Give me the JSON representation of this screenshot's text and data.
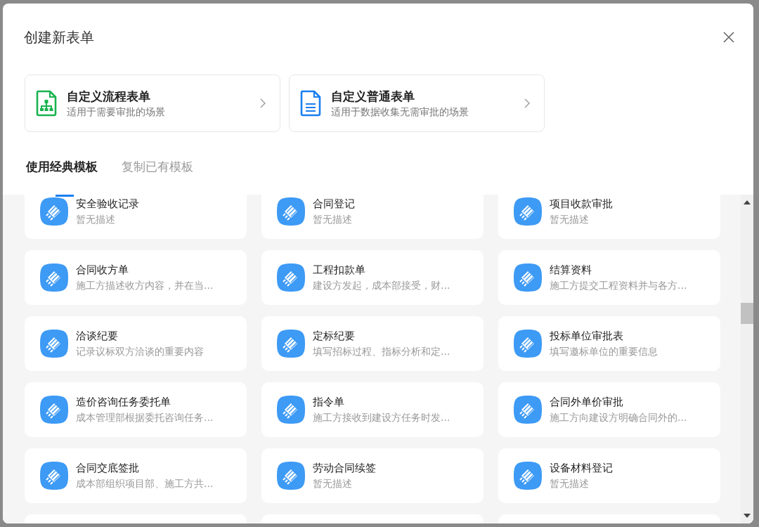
{
  "dialog": {
    "title": "创建新表单"
  },
  "create_options": [
    {
      "kind": "flow",
      "title": "自定义流程表单",
      "description": "适用于需要审批的场景"
    },
    {
      "kind": "normal",
      "title": "自定义普通表单",
      "description": "适用于数据收集无需审批的场景"
    }
  ],
  "tabs": [
    {
      "label": "使用经典模板",
      "selected": true
    },
    {
      "label": "复制已有模板",
      "selected": false
    }
  ],
  "templates": [
    {
      "name": "安全验收记录",
      "description": "暂无描述"
    },
    {
      "name": "合同登记",
      "description": "暂无描述"
    },
    {
      "name": "项目收款审批",
      "description": "暂无描述"
    },
    {
      "name": "合同收方单",
      "description": "施工方描述收方内容，并在当..."
    },
    {
      "name": "工程扣款单",
      "description": "建设方发起，成本部接受，财..."
    },
    {
      "name": "结算资料",
      "description": "施工方提交工程资料并与各方..."
    },
    {
      "name": "洽谈纪要",
      "description": "记录议标双方洽谈的重要内容"
    },
    {
      "name": "定标纪要",
      "description": "填写招标过程、指标分析和定..."
    },
    {
      "name": "投标单位审批表",
      "description": "填写邀标单位的重要信息"
    },
    {
      "name": "造价咨询任务委托单",
      "description": "成本管理部根据委托咨询任务..."
    },
    {
      "name": "指令单",
      "description": "施工方接收到建设方任务时发..."
    },
    {
      "name": "合同外单价审批",
      "description": "施工方向建设方明确合同外的..."
    },
    {
      "name": "合同交底签批",
      "description": "成本部组织项目部、施工方共..."
    },
    {
      "name": "劳动合同续签",
      "description": "暂无描述"
    },
    {
      "name": "设备材料登记",
      "description": "暂无描述"
    }
  ]
}
